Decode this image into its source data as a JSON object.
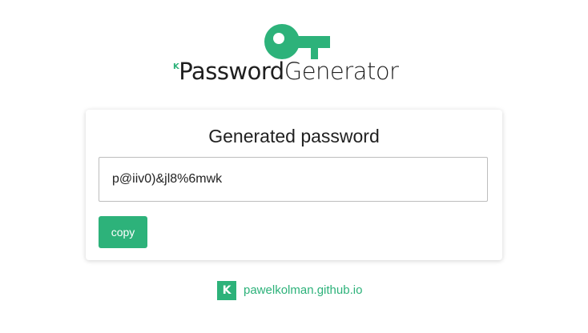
{
  "logo": {
    "mini_mark": "K",
    "word_bold": "Password",
    "word_light": "Generator",
    "accent_color": "#2db27a",
    "icon": "key-icon"
  },
  "card": {
    "title": "Generated password",
    "password_value": "p@iiv0)&jl8%6mwk",
    "copy_label": "copy"
  },
  "footer": {
    "badge_text": "K",
    "link_text": "pawelkolman.github.io"
  }
}
